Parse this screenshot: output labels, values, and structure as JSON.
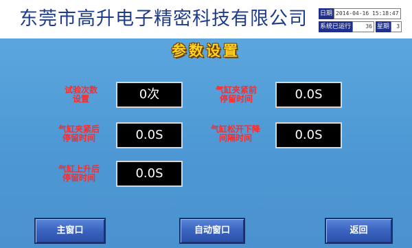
{
  "header": {
    "company": "东莞市高升电子精密科技有限公司",
    "date_label": "日期",
    "datetime": "2014-04-16 15:18:47",
    "runtime_label": "系统已运行",
    "runtime_value": "36",
    "week_label": "星期",
    "week_value": "3"
  },
  "panel": {
    "title": "参数设置",
    "params": [
      {
        "label_line1": "试验次数",
        "label_line2": "设置",
        "value": "0次"
      },
      {
        "label_line1": "气缸夹紧前",
        "label_line2": "停留时间",
        "value": "0.0S"
      },
      {
        "label_line1": "气缸夹紧后",
        "label_line2": "停留时间",
        "value": "0.0S"
      },
      {
        "label_line1": "气缸松开下降",
        "label_line2": "间隔时间",
        "value": "0.0S"
      },
      {
        "label_line1": "气缸上升后",
        "label_line2": "停留时间",
        "value": "0.0S"
      }
    ]
  },
  "buttons": {
    "main": "主窗口",
    "auto": "自动窗口",
    "back": "返回"
  },
  "colors": {
    "company_text": "#1f3c8c",
    "panel_bg": "#4d98d4",
    "title_text": "#ffd21e",
    "label_text": "#ff2a2a",
    "value_bg": "#000000",
    "button_bg": "#3a63c0"
  }
}
